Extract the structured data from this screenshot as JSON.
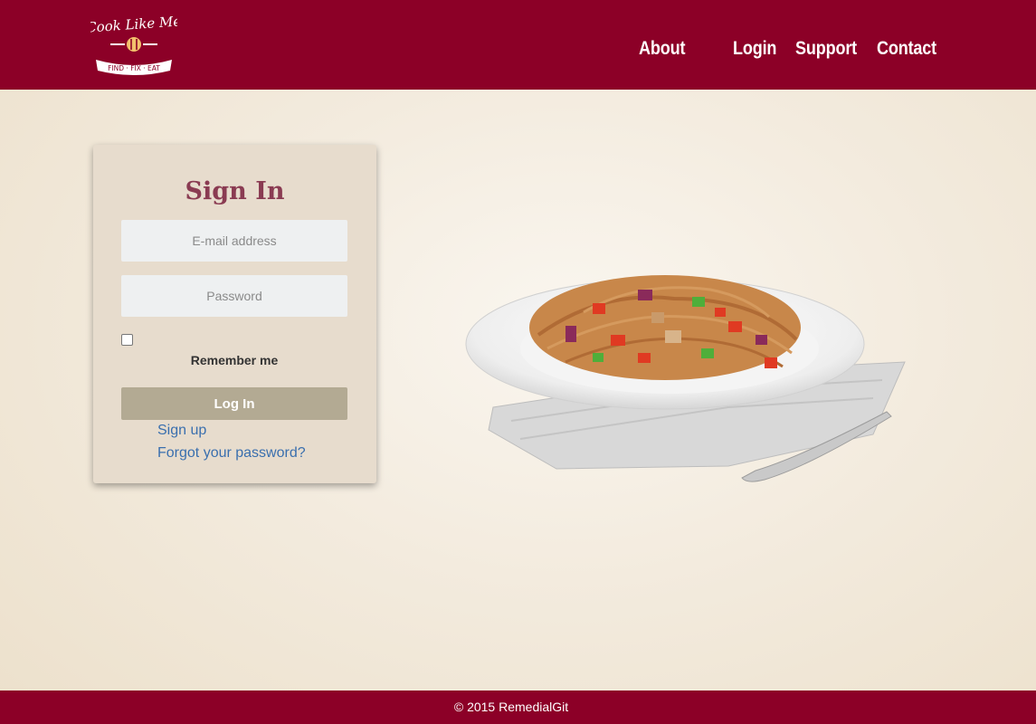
{
  "brand": {
    "name": "Cook Like Me",
    "tagline": "FIND · FIX · EAT"
  },
  "nav": {
    "items": [
      "About",
      "Login",
      "Support",
      "Contact"
    ]
  },
  "signin": {
    "title": "Sign In",
    "email_placeholder": "E-mail address",
    "password_placeholder": "Password",
    "remember_label": "Remember me",
    "login_button": "Log In",
    "signup_link": "Sign up",
    "forgot_link": "Forgot your password?"
  },
  "footer": {
    "copyright": "© 2015 RemedialGit"
  },
  "colors": {
    "brand": "#8c0027",
    "title": "#8a3b52",
    "button": "#b3aa93",
    "link": "#3a6fae"
  }
}
